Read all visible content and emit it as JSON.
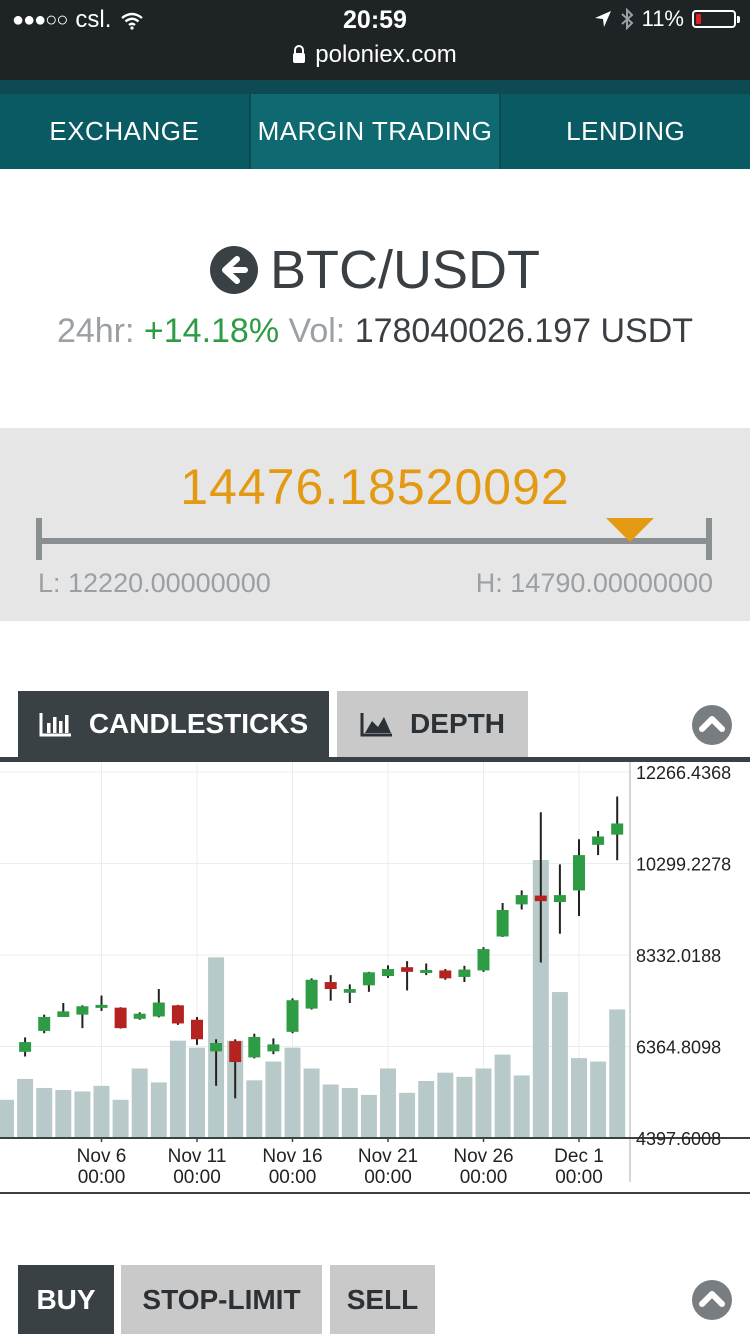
{
  "status": {
    "carrier": "csl.",
    "time": "20:59",
    "battery": "11%",
    "url": "poloniex.com"
  },
  "nav": {
    "items": [
      {
        "label": "EXCHANGE"
      },
      {
        "label": "MARGIN TRADING"
      },
      {
        "label": "LENDING"
      }
    ]
  },
  "pair": {
    "name": "BTC/USDT",
    "change_label": "24hr:",
    "change_value": "+14.18%",
    "vol_label": "Vol:",
    "vol_value": "178040026.197 USDT"
  },
  "price": {
    "last": "14476.18520092",
    "low_text": "L: 12220.00000000",
    "high_text": "H: 14790.00000000",
    "low": 12220.0,
    "high": 14790.0,
    "current": 14476.18520092
  },
  "chart_tabs": {
    "candlesticks": "CANDLESTICKS",
    "depth": "DEPTH"
  },
  "order_tabs": {
    "buy": "BUY",
    "stop_limit": "STOP-LIMIT",
    "sell": "SELL"
  },
  "colors": {
    "up": "#2e9c45",
    "down": "#b4231f",
    "volume": "#b8c9ca",
    "accent": "#e39a12",
    "nav": "#0a5a63"
  },
  "chart_data": {
    "type": "candlestick",
    "y_axis_ticks": [
      "12266.4368",
      "10299.2278",
      "8332.0188",
      "6364.8098",
      "4397.6008"
    ],
    "ylim": [
      4397.6008,
      12266.4368
    ],
    "x_axis_ticks": [
      {
        "date": "Nov 6",
        "time": "00:00",
        "index": 5
      },
      {
        "date": "Nov 11",
        "time": "00:00",
        "index": 10
      },
      {
        "date": "Nov 16",
        "time": "00:00",
        "index": 15
      },
      {
        "date": "Nov 21",
        "time": "00:00",
        "index": 20
      },
      {
        "date": "Nov 26",
        "time": "00:00",
        "index": 25
      },
      {
        "date": "Dec 1",
        "time": "00:00",
        "index": 30
      }
    ],
    "candles": [
      {
        "o": 6250,
        "c": 6460,
        "h": 6560,
        "l": 6150
      },
      {
        "o": 6700,
        "c": 7000,
        "h": 7050,
        "l": 6650
      },
      {
        "o": 7000,
        "c": 7120,
        "h": 7300,
        "l": 7000
      },
      {
        "o": 7050,
        "c": 7230,
        "h": 7250,
        "l": 6760
      },
      {
        "o": 7250,
        "c": 7260,
        "h": 7460,
        "l": 7130
      },
      {
        "o": 7200,
        "c": 6760,
        "h": 7210,
        "l": 6750
      },
      {
        "o": 6960,
        "c": 7070,
        "h": 7100,
        "l": 6940
      },
      {
        "o": 7010,
        "c": 7310,
        "h": 7600,
        "l": 6990
      },
      {
        "o": 7250,
        "c": 6860,
        "h": 7260,
        "l": 6830
      },
      {
        "o": 6940,
        "c": 6520,
        "h": 7000,
        "l": 6400
      },
      {
        "o": 6260,
        "c": 6440,
        "h": 6520,
        "l": 5520
      },
      {
        "o": 6480,
        "c": 6030,
        "h": 6520,
        "l": 5250
      },
      {
        "o": 6130,
        "c": 6570,
        "h": 6640,
        "l": 6110
      },
      {
        "o": 6260,
        "c": 6410,
        "h": 6540,
        "l": 6200
      },
      {
        "o": 6680,
        "c": 7360,
        "h": 7400,
        "l": 6650
      },
      {
        "o": 7180,
        "c": 7800,
        "h": 7830,
        "l": 7160
      },
      {
        "o": 7750,
        "c": 7600,
        "h": 7900,
        "l": 7350
      },
      {
        "o": 7520,
        "c": 7600,
        "h": 7700,
        "l": 7300
      },
      {
        "o": 7680,
        "c": 7960,
        "h": 7970,
        "l": 7540
      },
      {
        "o": 7880,
        "c": 8030,
        "h": 8110,
        "l": 7840
      },
      {
        "o": 8070,
        "c": 7970,
        "h": 8200,
        "l": 7570
      },
      {
        "o": 7970,
        "c": 8010,
        "h": 8150,
        "l": 7900
      },
      {
        "o": 8000,
        "c": 7830,
        "h": 8030,
        "l": 7800
      },
      {
        "o": 7860,
        "c": 8020,
        "h": 8100,
        "l": 7750
      },
      {
        "o": 8000,
        "c": 8460,
        "h": 8500,
        "l": 7970
      },
      {
        "o": 8730,
        "c": 9300,
        "h": 9450,
        "l": 8720
      },
      {
        "o": 9420,
        "c": 9620,
        "h": 9720,
        "l": 9310
      },
      {
        "o": 9610,
        "c": 9490,
        "h": 11400,
        "l": 8170
      },
      {
        "o": 9470,
        "c": 9620,
        "h": 10280,
        "l": 8790
      },
      {
        "o": 9720,
        "c": 10480,
        "h": 10820,
        "l": 9170
      },
      {
        "o": 10700,
        "c": 10880,
        "h": 11000,
        "l": 10480
      },
      {
        "o": 10920,
        "c": 11160,
        "h": 11740,
        "l": 10370
      }
    ],
    "volume": [
      5.5,
      8.5,
      7.2,
      6.9,
      6.7,
      7.5,
      5.5,
      10,
      8,
      14,
      13,
      26,
      14,
      8.3,
      11,
      13,
      10,
      7.7,
      7.2,
      6.2,
      10,
      6.5,
      8.2,
      9.4,
      8.8,
      10,
      12,
      9,
      40,
      21,
      11.5,
      11,
      18.5
    ]
  }
}
